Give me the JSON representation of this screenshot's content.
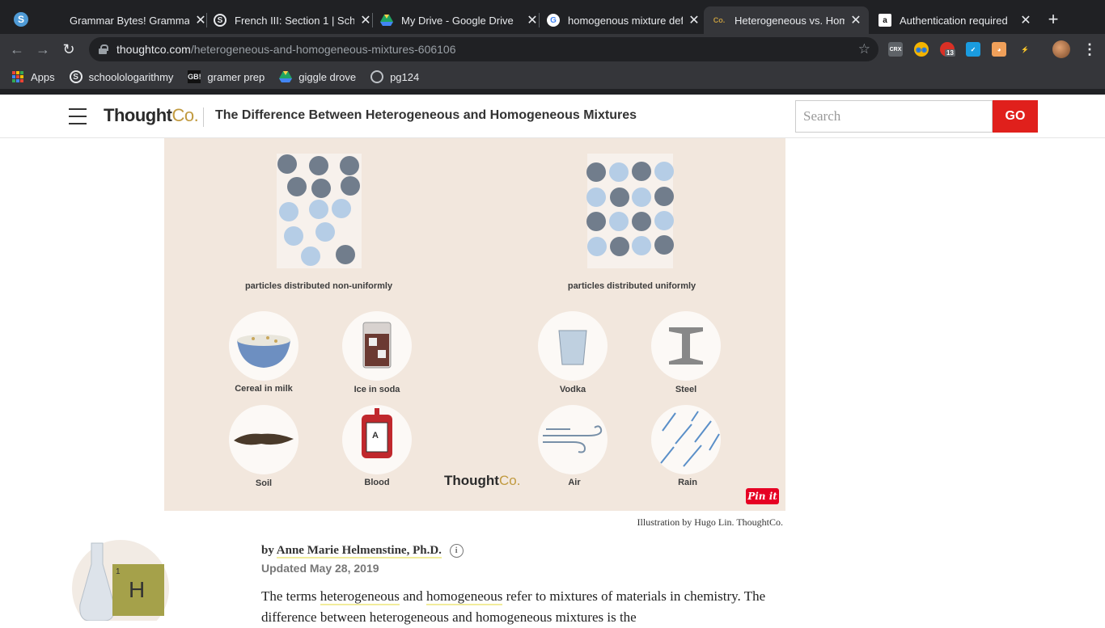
{
  "tabs": [
    {
      "title": "Grammar Bytes! Gramma",
      "icon": "blank-icon",
      "active": false
    },
    {
      "title": "French III: Section 1 | Sch",
      "icon": "schoology-icon",
      "active": false
    },
    {
      "title": "My Drive - Google Drive",
      "icon": "google-drive-icon",
      "active": false
    },
    {
      "title": "homogenous mixture def",
      "icon": "google-icon",
      "active": false
    },
    {
      "title": "Heterogeneous vs. Homo",
      "icon": "thoughtco-icon",
      "active": true
    },
    {
      "title": "Authentication required",
      "icon": "amazon-icon",
      "active": false
    }
  ],
  "omnibox": {
    "host": "thoughtco.com",
    "path": "/heterogeneous-and-homogeneous-mixtures-606106"
  },
  "extensions": {
    "badge": "13"
  },
  "bookmarks": [
    {
      "label": "Apps",
      "icon": "apps-grid-icon"
    },
    {
      "label": "schoolologarithmy",
      "icon": "schoology-icon"
    },
    {
      "label": "gramer prep",
      "icon": "grammar-bytes-icon"
    },
    {
      "label": "giggle drove",
      "icon": "google-drive-icon"
    },
    {
      "label": "pg124",
      "icon": "globe-icon"
    }
  ],
  "site": {
    "brand_main": "Thought",
    "brand_co": "Co.",
    "headline": "The Difference Between Heterogeneous and Homogeneous Mixtures",
    "search_placeholder": "Search",
    "go_label": "GO"
  },
  "figure": {
    "left_caption": "particles distributed non-uniformly",
    "right_caption": "particles distributed uniformly",
    "items": [
      {
        "label": "Cereal in milk",
        "icon": "cereal-bowl-icon"
      },
      {
        "label": "Ice in soda",
        "icon": "soda-glass-icon"
      },
      {
        "label": "Vodka",
        "icon": "vodka-glass-icon"
      },
      {
        "label": "Steel",
        "icon": "steel-beam-icon"
      },
      {
        "label": "Soil",
        "icon": "soil-icon"
      },
      {
        "label": "Blood",
        "icon": "blood-bag-icon"
      },
      {
        "label": "Air",
        "icon": "wind-icon"
      },
      {
        "label": "Rain",
        "icon": "rain-icon"
      }
    ],
    "logo_main": "Thought",
    "logo_co": "Co.",
    "pin_label": "Pin it",
    "blood_letter": "A"
  },
  "credit": "Illustration by Hugo Lin. ThoughtCo.",
  "article": {
    "by": "by",
    "author": "Anne Marie Helmenstine, Ph.D.",
    "info": "i",
    "updated": "Updated May 28, 2019",
    "avatar_symbol": "H",
    "avatar_number": "1",
    "body_1": "The terms ",
    "term_1": "heterogeneous",
    "body_2": " and ",
    "term_2": "homogeneous",
    "body_3": " refer to mixtures of materials in chemistry. The difference between heterogeneous and homogeneous mixtures is the"
  }
}
